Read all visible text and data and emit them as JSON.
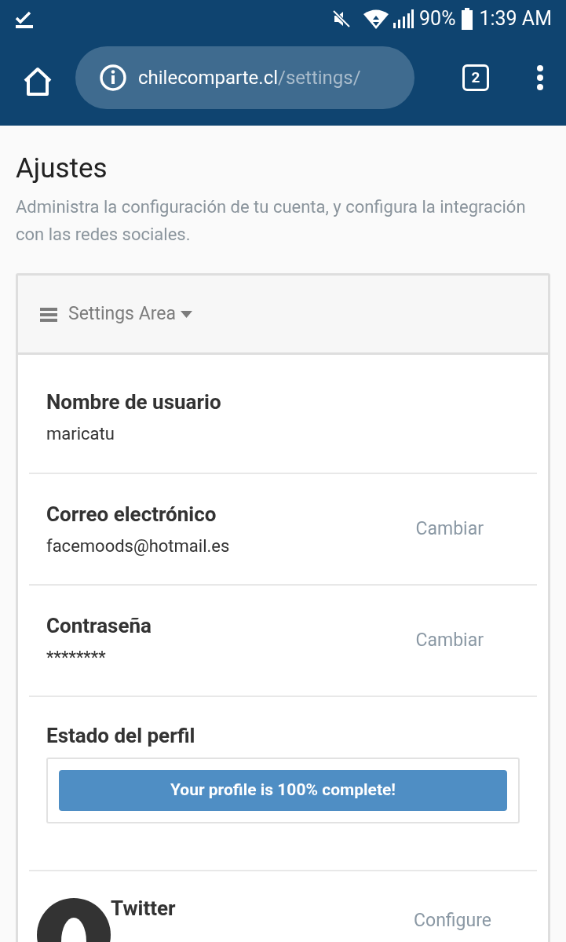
{
  "status_bar": {
    "battery": "90%",
    "time": "1:39 AM"
  },
  "browser": {
    "url_host": "chilecomparte.cl",
    "url_path": "/settings/",
    "tab_count": "2"
  },
  "page": {
    "title": "Ajustes",
    "description": "Administra la configuración de tu cuenta, y configura la integración con las redes sociales."
  },
  "settings_menu": {
    "label": "Settings Area"
  },
  "fields": [
    {
      "kind": "field",
      "label": "Nombre de usuario",
      "value": "maricatu"
    },
    {
      "kind": "field",
      "label": "Correo electrónico",
      "value": "facemoods@hotmail.es",
      "action": "Cambiar"
    },
    {
      "kind": "field",
      "label": "Contraseña",
      "value": "********",
      "action": "Cambiar"
    },
    {
      "kind": "progress",
      "label": "Estado del perfil",
      "bar_text": "Your profile is 100% complete!"
    },
    {
      "kind": "social",
      "label": "Twitter",
      "action": "Configure"
    }
  ]
}
